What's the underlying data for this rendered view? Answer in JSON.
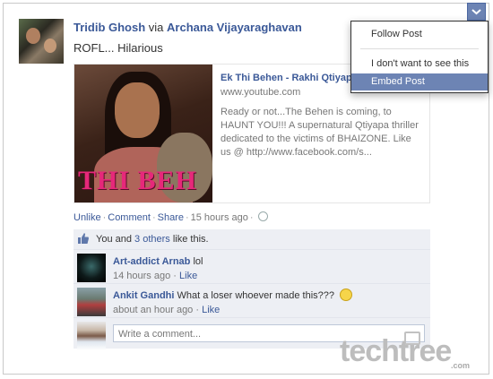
{
  "post": {
    "author": "Tridib Ghosh",
    "via_text": "via",
    "via_author": "Archana Vijayaraghavan",
    "status": "ROFL... Hilarious",
    "shared_link": {
      "title": "Ek Thi Behen - Rakhi Qtiyapa",
      "domain": "www.youtube.com",
      "description": "Ready or not...The Behen is coming, to HAUNT YOU!!! A supernatural Qtiyapa thriller dedicated to the victims of BHAIZONE. Like us @ http://www.facebook.com/s...",
      "thumbnail_text": "THI BEH"
    },
    "actions": {
      "unlike": "Unlike",
      "comment": "Comment",
      "share": "Share",
      "timestamp": "15 hours ago",
      "privacy_icon": "globe-icon"
    }
  },
  "likes": {
    "prefix": "You and",
    "others_link": "3 others",
    "suffix": "like this."
  },
  "comments": [
    {
      "author": "Art-addict Arnab",
      "text": "lol",
      "time": "14 hours ago",
      "like": "Like"
    },
    {
      "author": "Ankit Gandhi",
      "text": "What a loser whoever made this???",
      "time": "about an hour ago",
      "like": "Like"
    }
  ],
  "write_comment": {
    "placeholder": "Write a comment..."
  },
  "menu": {
    "items": [
      "Follow Post",
      "I don't want to see this",
      "Embed Post"
    ],
    "active_index": 2,
    "accent": "#6d84b4"
  },
  "watermark": {
    "brand": "techtree",
    "suffix": ".com"
  }
}
